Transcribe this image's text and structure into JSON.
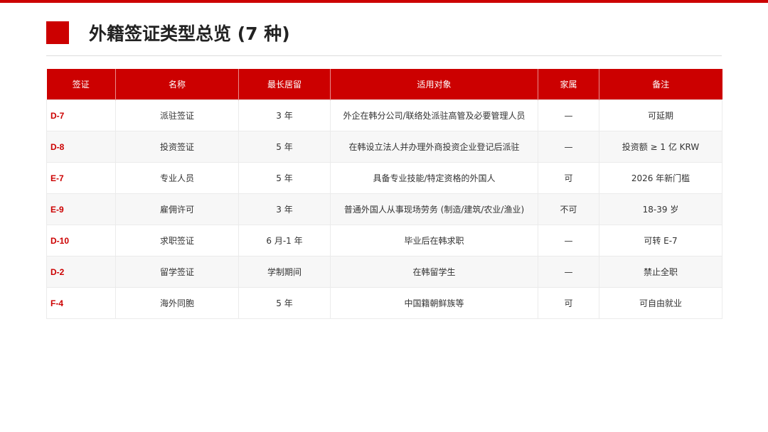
{
  "title": "外籍签证类型总览 (7 种)",
  "colors": {
    "accent": "#cc0000",
    "row_alt": "#f7f7f7"
  },
  "table": {
    "headers": [
      "签证",
      "名称",
      "最长居留",
      "适用对象",
      "家属",
      "备注"
    ],
    "rows": [
      [
        "D-7",
        "派驻签证",
        "3 年",
        "外企在韩分公司/联络处派驻高管及必要管理人员",
        "—",
        "可延期"
      ],
      [
        "D-8",
        "投资签证",
        "5 年",
        "在韩设立法人并办理外商投资企业登记后派驻",
        "—",
        "投资额 ≥ 1 亿 KRW"
      ],
      [
        "E-7",
        "专业人员",
        "5 年",
        "具备专业技能/特定资格的外国人",
        "可",
        "2026 年新门槛"
      ],
      [
        "E-9",
        "雇佣许可",
        "3 年",
        "普通外国人从事现场劳务 (制造/建筑/农业/渔业)",
        "不可",
        "18-39 岁"
      ],
      [
        "D-10",
        "求职签证",
        "6 月-1 年",
        "毕业后在韩求职",
        "—",
        "可转 E-7"
      ],
      [
        "D-2",
        "留学签证",
        "学制期间",
        "在韩留学生",
        "—",
        "禁止全职"
      ],
      [
        "F-4",
        "海外同胞",
        "5 年",
        "中国籍朝鲜族等",
        "可",
        "可自由就业"
      ]
    ]
  }
}
